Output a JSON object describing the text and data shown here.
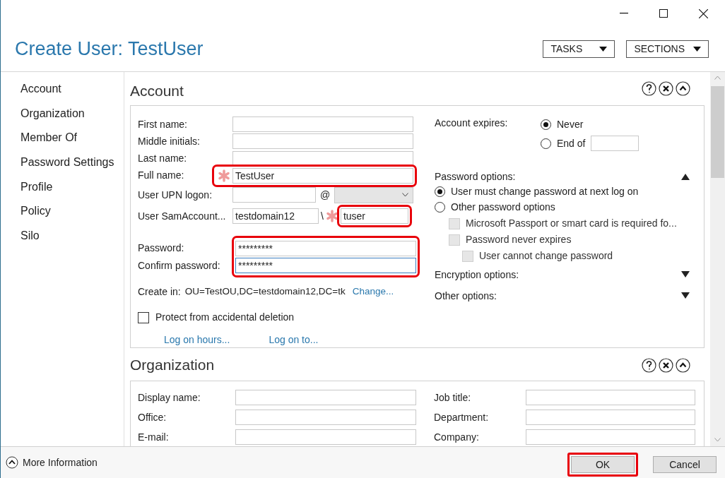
{
  "window": {
    "title": "Create User: TestUser"
  },
  "header_buttons": [
    {
      "label": "TASKS"
    },
    {
      "label": "SECTIONS"
    }
  ],
  "sidebar": {
    "items": [
      {
        "label": "Account"
      },
      {
        "label": "Organization"
      },
      {
        "label": "Member Of"
      },
      {
        "label": "Password Settings"
      },
      {
        "label": "Profile"
      },
      {
        "label": "Policy"
      },
      {
        "label": "Silo"
      }
    ]
  },
  "account": {
    "title": "Account",
    "name_fields": [
      {
        "label": "First name:",
        "required": false,
        "highlighted": false
      },
      {
        "label": "Middle initials:",
        "required": false,
        "highlighted": false
      },
      {
        "label": "Last name:",
        "required": false,
        "highlighted": false
      },
      {
        "label": "Full name:",
        "value": "TestUser",
        "required": true,
        "highlighted": true
      }
    ],
    "upn": {
      "label": "User UPN logon:",
      "separator": "@"
    },
    "sam": {
      "label": "User SamAccount...",
      "domain": "testdomain12",
      "separator": "\\",
      "value": "tuser",
      "required": true,
      "highlighted": true
    },
    "passwords": {
      "highlighted": true,
      "fields": [
        {
          "label": "Password:",
          "value": "*********",
          "focused": false
        },
        {
          "label": "Confirm password:",
          "value": "*********",
          "focused": true
        }
      ]
    },
    "create_in": {
      "label": "Create in:",
      "value": "OU=TestOU,DC=testdomain12,DC=tk",
      "link": "Change..."
    },
    "protect": {
      "label": "Protect from accidental deletion",
      "checked": false
    },
    "links": [
      "Log on hours...",
      "Log on to..."
    ],
    "account_expires": {
      "label": "Account expires:",
      "options": [
        {
          "label": "Never",
          "selected": true
        },
        {
          "label": "End of",
          "selected": false
        }
      ]
    },
    "password_options": {
      "label": "Password options:",
      "expanded": true,
      "options": [
        {
          "label": "User must change password at next log on",
          "selected": true
        },
        {
          "label": "Other password options",
          "selected": false
        }
      ],
      "checkboxes": [
        {
          "label": "Microsoft Passport or smart card is required fo...",
          "checked": false,
          "disabled": true
        },
        {
          "label": "Password never expires",
          "checked": false,
          "disabled": true,
          "children": [
            {
              "label": "User cannot change password",
              "checked": false,
              "disabled": true
            }
          ]
        }
      ]
    },
    "option_groups": [
      {
        "label": "Encryption options:",
        "expanded": false
      },
      {
        "label": "Other options:",
        "expanded": false
      }
    ]
  },
  "organization": {
    "title": "Organization",
    "left_fields": [
      {
        "label": "Display name:"
      },
      {
        "label": "Office:"
      },
      {
        "label": "E-mail:"
      }
    ],
    "right_fields": [
      {
        "label": "Job title:"
      },
      {
        "label": "Department:"
      },
      {
        "label": "Company:"
      }
    ]
  },
  "footer": {
    "more_info": "More Information",
    "buttons": [
      {
        "label": "OK",
        "highlighted": true
      },
      {
        "label": "Cancel",
        "highlighted": false
      }
    ]
  }
}
